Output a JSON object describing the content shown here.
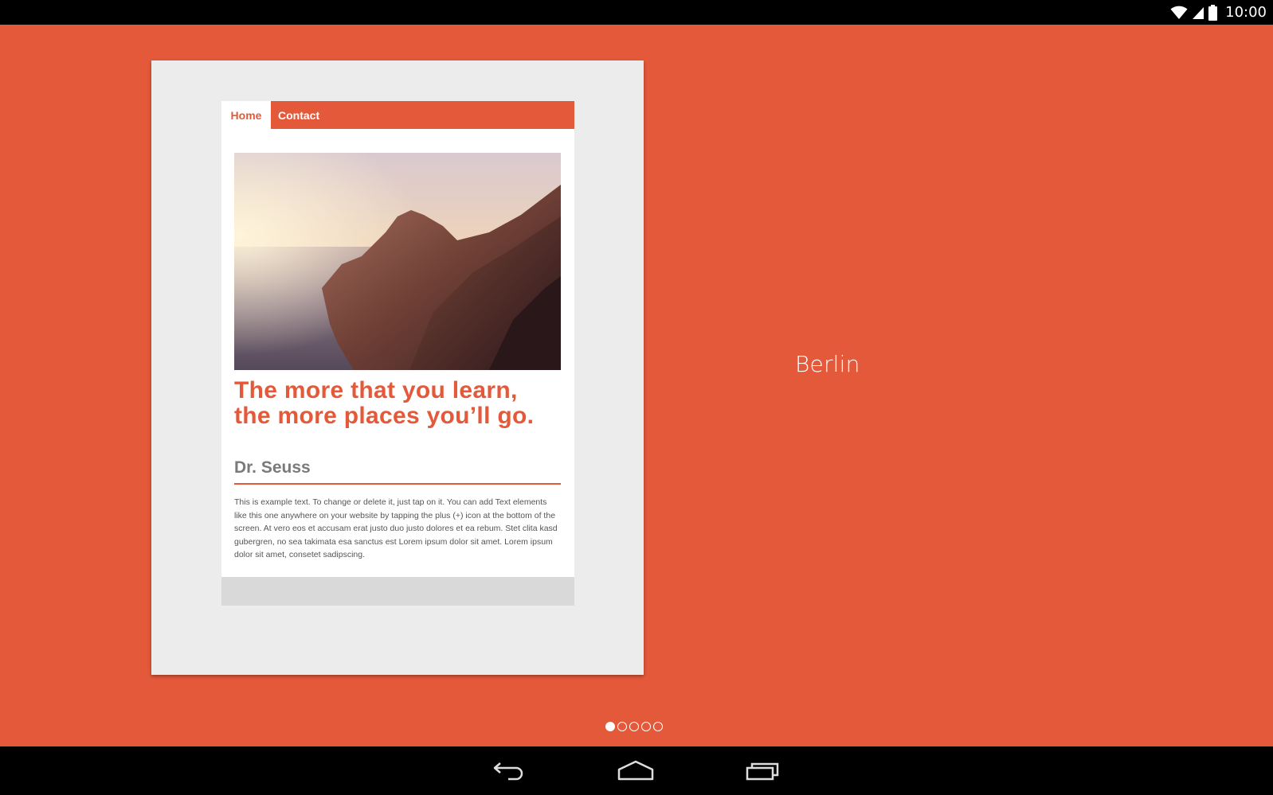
{
  "status_bar": {
    "time": "10:00",
    "icons": [
      "wifi-icon",
      "cell-signal-icon",
      "battery-icon"
    ]
  },
  "preview": {
    "nav": {
      "home_label": "Home",
      "contact_label": "Contact"
    },
    "hero_image": "coastal-cliffs-sunset",
    "quote": "The more that you learn, the more places you’ll go.",
    "author": "Dr. Seuss",
    "body": "This is example text. To change or delete it, just tap on it. You can add Text elements like this one anywhere on your website by tapping the plus (+) icon at the bottom of the screen. At vero eos et accusam erat justo duo justo dolores et ea rebum. Stet clita kasd gubergren, no sea takimata esa sanctus est Lorem ipsum dolor sit amet. Lorem ipsum dolor sit amet, consetet sadipscing."
  },
  "theme": {
    "name": "Berlin"
  },
  "pager": {
    "total": 5,
    "active_index": 0
  },
  "nav_bar": {
    "buttons": [
      "back-icon",
      "home-icon",
      "recents-icon"
    ]
  },
  "colors": {
    "accent": "#E4593A",
    "card_bg": "#ECECEC",
    "footer_bg": "#D9D9D9",
    "author_gray": "#7a7a7a"
  }
}
